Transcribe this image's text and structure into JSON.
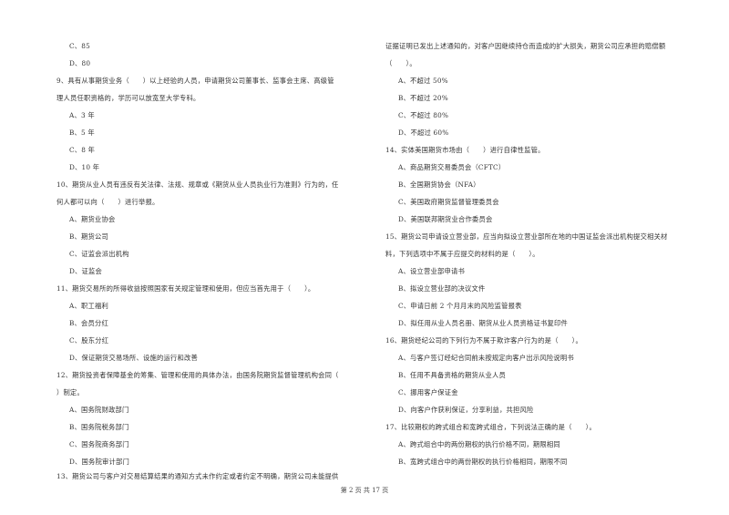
{
  "page": {
    "footer": "第 2 页 共 17 页"
  },
  "left_column": {
    "q8_tail": {
      "options": [
        "C、85",
        "D、80"
      ]
    },
    "q9": {
      "stem_line1": "9、具有从事期货业务（　　）以上经验的人员，申请期货公司董事长、监事会主席、高级管",
      "stem_line2": "理人员任职资格的，学历可以放宽至大学专科。",
      "options": [
        "A、3 年",
        "B、5 年",
        "C、8 年",
        "D、10 年"
      ]
    },
    "q10": {
      "stem_line1": "10、期货从业人员有违反有关法律、法规、规章或《期货从业人员执业行为准则》行为的，任",
      "stem_line2": "何人都可以向（　　）进行举报。",
      "options": [
        "A、期货业协会",
        "B、期货公司",
        "C、证监会派出机构",
        "D、证监会"
      ]
    },
    "q11": {
      "stem_line1": "11、期货交易所的所得收益按照国家有关规定管理和使用，但应当首先用于（　　）。",
      "options": [
        "A、职工福利",
        "B、会员分红",
        "C、股东分红",
        "D、保证期货交易场所、设施的运行和改善"
      ]
    },
    "q12": {
      "stem_line1": "12、期货投资者保障基金的筹集、管理和使用的具体办法，由国务院期货监督管理机构会同（",
      "stem_line2": "）制定。",
      "options": [
        "A、国务院财政部门",
        "B、国务院税务部门",
        "C、国务院商务部门",
        "D、国务院审计部门"
      ]
    },
    "q13": {
      "stem_line1": "13、期货公司与客户对交易结算结果的通知方式未作约定或者约定不明确，期货公司未能提供"
    }
  },
  "right_column": {
    "q13_tail": {
      "stem_line2": "证据证明已发出上述通知的，对客户因继续持仓而造成的扩大损失，期货公司应承担的赔偿额",
      "stem_line3": "（　　）。",
      "options": [
        "A、不超过 50%",
        "B、不超过 20%",
        "C、不超过 80%",
        "D、不超过 60%"
      ]
    },
    "q14": {
      "stem_line1": "14、实体美国期货市场由（　　）进行自律性监管。",
      "options": [
        "A、商品期货交易委员会（CFTC）",
        "B、全国期货协会（NFA）",
        "C、美国政府期货监督管理委员会",
        "D、美国联邦期货业合作委员会"
      ]
    },
    "q15": {
      "stem_line1": "15、期货公司申请设立营业部，应当向拟设立营业部所在地的中国证监会派出机构提交相关材",
      "stem_line2": "料，下列选项中不属于应提交的材料的是（　　）。",
      "options": [
        "A、设立营业部申请书",
        "B、拟设立营业部的决议文件",
        "C、申请日前 2 个月月末的风险监管报表",
        "D、拟任用从业人员名册、期货从业人员资格证书复印件"
      ]
    },
    "q16": {
      "stem_line1": "16、期货经纪公司的下列行为不属于欺诈客户行为的是（　　）。",
      "options": [
        "A、与客户签订经纪合同前未按规定向客户出示风险说明书",
        "B、任用不具备资格的期货从业人员",
        "C、挪用客户保证金",
        "D、向客户作获利保证，分享利益，共担风险"
      ]
    },
    "q17": {
      "stem_line1": "17、比较期权的跨式组合和宽跨式组合，下列说法正确的是（　　）。",
      "options": [
        "A、跨式组合中的两份期权的执行价格不同，期限相同",
        "B、宽跨式组合中的两份期权的执行价格相同，期限不同"
      ]
    }
  }
}
